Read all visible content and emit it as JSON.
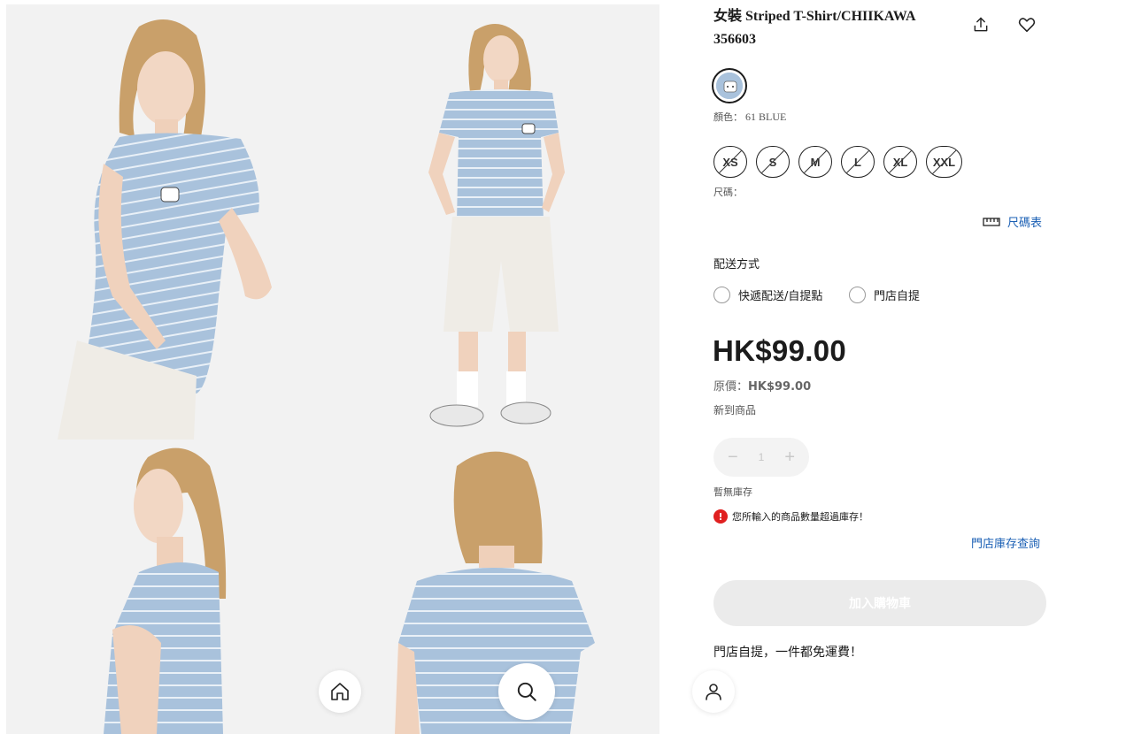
{
  "product": {
    "title": "女裝 Striped T-Shirt/CHIIKAWA 356603",
    "color_label": "顏色：",
    "color_value": "61 BLUE",
    "sizes": [
      "XS",
      "S",
      "M",
      "L",
      "XL",
      "XXL"
    ],
    "size_label": "尺碼：",
    "size_chart_label": "尺碼表"
  },
  "shipping": {
    "title": "配送方式",
    "options": [
      "快遞配送/自提點",
      "門店自提"
    ]
  },
  "pricing": {
    "price": "HK$99.00",
    "original_label": "原價：",
    "original_value": "HK$99.00",
    "badge": "新到商品"
  },
  "quantity": {
    "value": "1",
    "minus": "−",
    "plus": "+"
  },
  "stock": {
    "status": "暫無庫存",
    "warning_symbol": "!",
    "warning": "您所輸入的商品數量超過庫存！",
    "store_link": "門店庫存查詢"
  },
  "cart": {
    "add_label": "加入購物車"
  },
  "promo": "門店自提，一件都免運費！",
  "icons": {
    "share": "share-icon",
    "favorite": "heart-icon",
    "size_chart": "ruler-icon",
    "home": "home-icon",
    "search": "search-icon",
    "account": "user-icon"
  },
  "colors": {
    "shirt_blue": "#a9c2dc",
    "link_blue": "#1a5fb4",
    "warning_red": "#e02020",
    "disabled_button": "#ebebeb"
  }
}
